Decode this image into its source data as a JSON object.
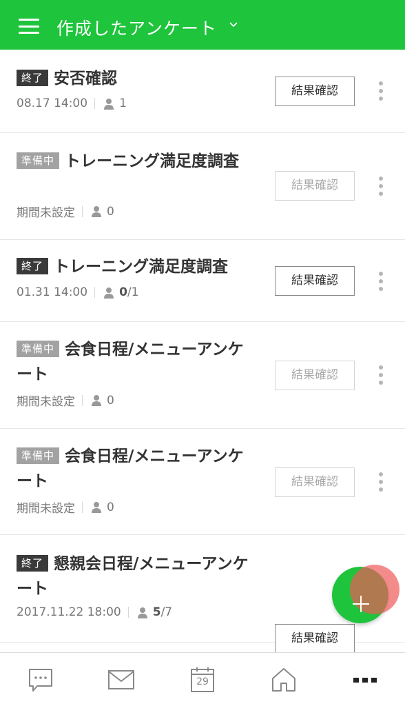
{
  "header": {
    "title": "作成したアンケート"
  },
  "surveys": [
    {
      "status": "終了",
      "title": "安否確認",
      "meta": "08.17 14:00",
      "count_strong": "",
      "count_rest": "1",
      "button": "結果確認"
    },
    {
      "status": "準備中",
      "title": "トレーニング満足度調査",
      "meta": "期間未設定",
      "count_strong": "",
      "count_rest": "0",
      "button": "結果確認"
    },
    {
      "status": "終了",
      "title": "トレーニング満足度調査",
      "meta": "01.31 14:00",
      "count_strong": "0",
      "count_rest": "/1",
      "button": "結果確認"
    },
    {
      "status": "準備中",
      "title": "会食日程/メニューアンケート",
      "meta": "期間未設定",
      "count_strong": "",
      "count_rest": "0",
      "button": "結果確認"
    },
    {
      "status": "準備中",
      "title": "会食日程/メニューアンケート",
      "meta": "期間未設定",
      "count_strong": "",
      "count_rest": "0",
      "button": "結果確認"
    },
    {
      "status": "終了",
      "title": "懇親会日程/メニューアンケート",
      "meta": "2017.11.22 18:00",
      "count_strong": "5",
      "count_rest": "/7",
      "button": "結果確認"
    }
  ],
  "tabbar": {
    "calendar_day": "29"
  },
  "colors": {
    "brand": "#1ec43b",
    "ended_badge": "#3a3a3a",
    "prep_badge": "#a2a2a2"
  }
}
